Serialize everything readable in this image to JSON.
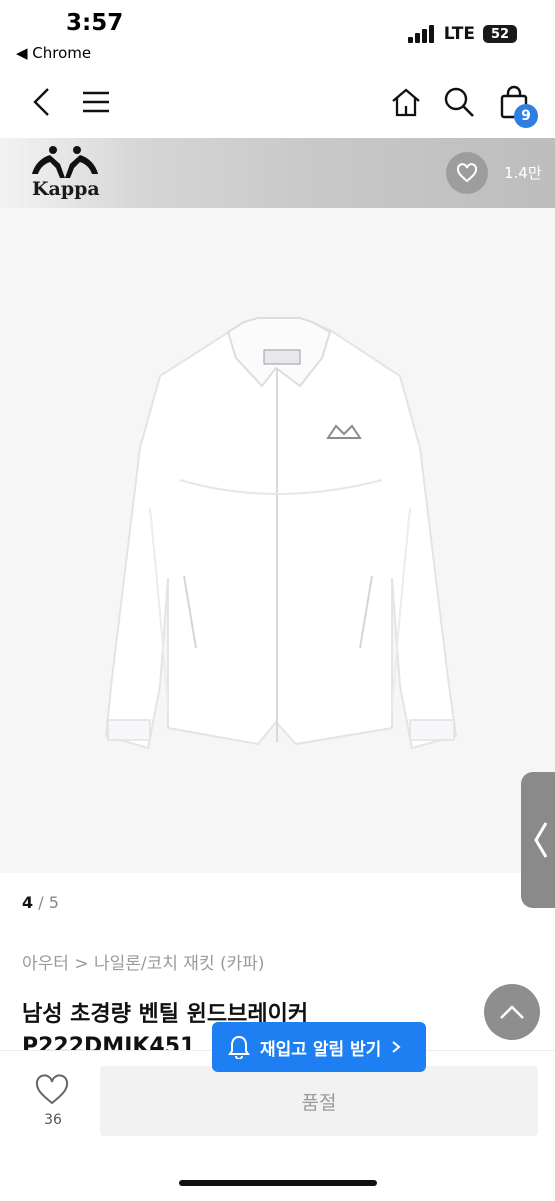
{
  "status_bar": {
    "time": "3:57",
    "back_app": "◀ Chrome",
    "network": "LTE",
    "battery": "52"
  },
  "nav": {
    "cart_count": "9"
  },
  "brand": {
    "name": "Kappa",
    "likes": "1.4만"
  },
  "gallery": {
    "current": "4",
    "separator": " / ",
    "total": "5"
  },
  "product": {
    "breadcrumb": "아우터 > 나일론/코치 재킷 (카파)",
    "title": "남성 초경량 벤틸 윈드브레이커",
    "code": "P222DMJK451"
  },
  "bottom": {
    "wish_count": "36",
    "soldout_label": "품절",
    "restock_label": "재입고 알림 받기"
  },
  "colors": {
    "accent": "#1d7ff2",
    "badge": "#2f7fe3"
  }
}
